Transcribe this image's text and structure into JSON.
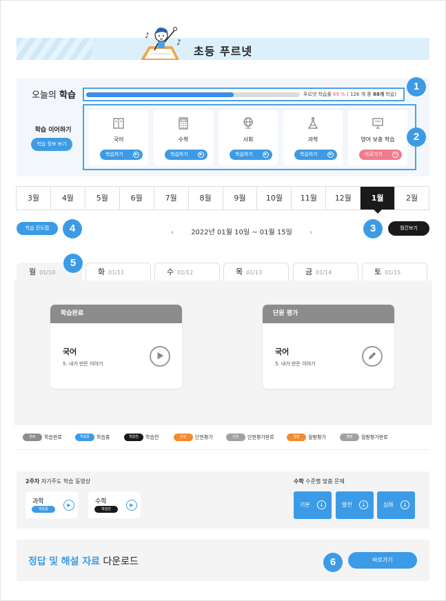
{
  "banner": {
    "title": "초등 푸르넷"
  },
  "today": {
    "title_prefix": "오늘의",
    "title_bold": "학습",
    "progress_percent": 69,
    "progress_label_prefix": "푸르넷 학습률",
    "progress_percent_text": "69 %",
    "progress_detail_a": "( 126 개 중",
    "progress_detail_bold": "88개",
    "progress_detail_b": "학습)",
    "continue_label": "학습 이어하기",
    "info_button": "학습 정보 보기",
    "subjects": [
      {
        "name": "국어",
        "button": "학습하기",
        "icon": "book-icon"
      },
      {
        "name": "수학",
        "button": "학습하기",
        "icon": "calculator-icon"
      },
      {
        "name": "사회",
        "button": "학습하기",
        "icon": "globe-icon"
      },
      {
        "name": "과학",
        "button": "학습하기",
        "icon": "flask-icon"
      },
      {
        "name": "영어 보충 학습",
        "button": "바로가기",
        "icon": "presentation-board-icon"
      }
    ]
  },
  "months": [
    "3월",
    "4월",
    "5월",
    "6월",
    "7월",
    "8월",
    "9월",
    "10월",
    "11월",
    "12월",
    "1월",
    "2월"
  ],
  "active_month": "1월",
  "week": {
    "progress_button": "학습 진도맵",
    "range": "2022년 01월 10일 ~ 01월 15일",
    "weekly_button": "월간보기",
    "prev_arrow": "‹",
    "next_arrow": "›"
  },
  "days": [
    {
      "day": "월",
      "date": "01/10"
    },
    {
      "day": "화",
      "date": "01/11"
    },
    {
      "day": "수",
      "date": "01/12"
    },
    {
      "day": "목",
      "date": "01/13"
    },
    {
      "day": "금",
      "date": "01/14"
    },
    {
      "day": "토",
      "date": "01/15"
    }
  ],
  "active_day": "월",
  "lessons": [
    {
      "header": "학습완료",
      "subject": "국어",
      "lesson": "5. 내가 만든 이야기",
      "action": "play-icon"
    },
    {
      "header": "단원 평가",
      "subject": "국어",
      "lesson": "5. 내가 만든 이야기",
      "action": "pencil-icon"
    }
  ],
  "legend": [
    {
      "chip": "완료",
      "label": "학습완료",
      "color": "#8c8c8c"
    },
    {
      "chip": "학습중",
      "label": "학습중",
      "color": "#3c9be6"
    },
    {
      "chip": "학습전",
      "label": "학습전",
      "color": "#1a1a1a"
    },
    {
      "chip": "단원",
      "label": "단원평가",
      "color": "#f58a2c"
    },
    {
      "chip": "단원",
      "label": "단원평가완료",
      "color": "#a0a0a0"
    },
    {
      "chip": "월말",
      "label": "월말평가",
      "color": "#f58a2c"
    },
    {
      "chip": "월말",
      "label": "월말평가완료",
      "color": "#a0a0a0"
    }
  ],
  "videos": {
    "title_bold": "2주차",
    "title_rest": "자기주도 학습 동영상",
    "items": [
      {
        "subject": "과학",
        "status": "학습중",
        "color": "#3c9be6"
      },
      {
        "subject": "수학",
        "status": "학습전",
        "color": "#1a1a1a"
      }
    ]
  },
  "levels": {
    "title_bold": "수학",
    "title_rest": "수준별 맞춤 문제",
    "items": [
      "기본",
      "발전",
      "심화"
    ]
  },
  "download": {
    "text_blue_1": "정답",
    "text_mid": "및",
    "text_blue_2": "해설 자료",
    "text_rest": "다운로드",
    "button": "바로가기"
  },
  "badges": [
    "1",
    "2",
    "3",
    "4",
    "5",
    "6"
  ],
  "colors": {
    "accent": "#3c9be6",
    "dark": "#1a1a1a",
    "pink": "#f07c8b",
    "highlight": "#ef4d6b"
  }
}
